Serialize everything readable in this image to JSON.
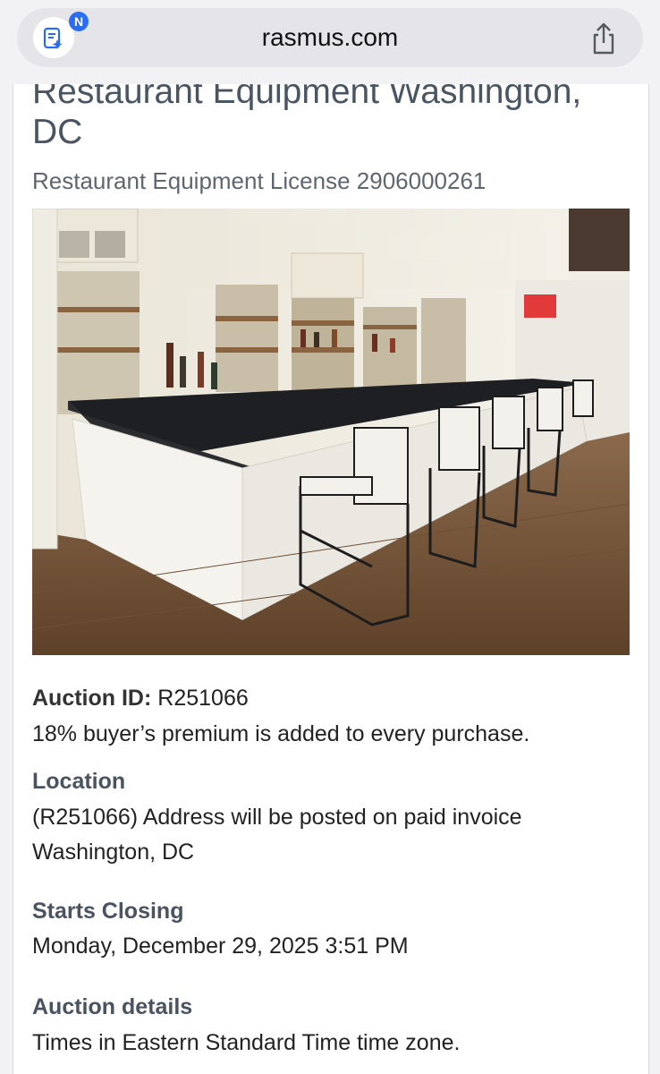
{
  "browser": {
    "url": "rasmus.com",
    "extension_badge": "N",
    "extension_icon": "notes-sparkle-icon",
    "share_icon": "share-icon"
  },
  "listing": {
    "title": "Restaurant Equipment Washington, DC",
    "license": "Restaurant Equipment License 2906000261",
    "photo_description_icon": "bar-counter-photo",
    "auction_id_label": "Auction ID:",
    "auction_id": "R251066",
    "premium_note": "18% buyer’s premium is added to every purchase.",
    "location_label": "Location",
    "location_line1": "(R251066) Address will be posted on paid invoice",
    "location_line2": "Washington, DC",
    "closing_label": "Starts Closing",
    "closing_value": "Monday, December 29, 2025 3:51 PM",
    "details_label": "Auction details",
    "details_value": "Times in Eastern Standard Time time zone."
  },
  "colors": {
    "title": "#4a5562",
    "badge": "#2a6df4",
    "browser_bg": "#f2f2f5"
  }
}
